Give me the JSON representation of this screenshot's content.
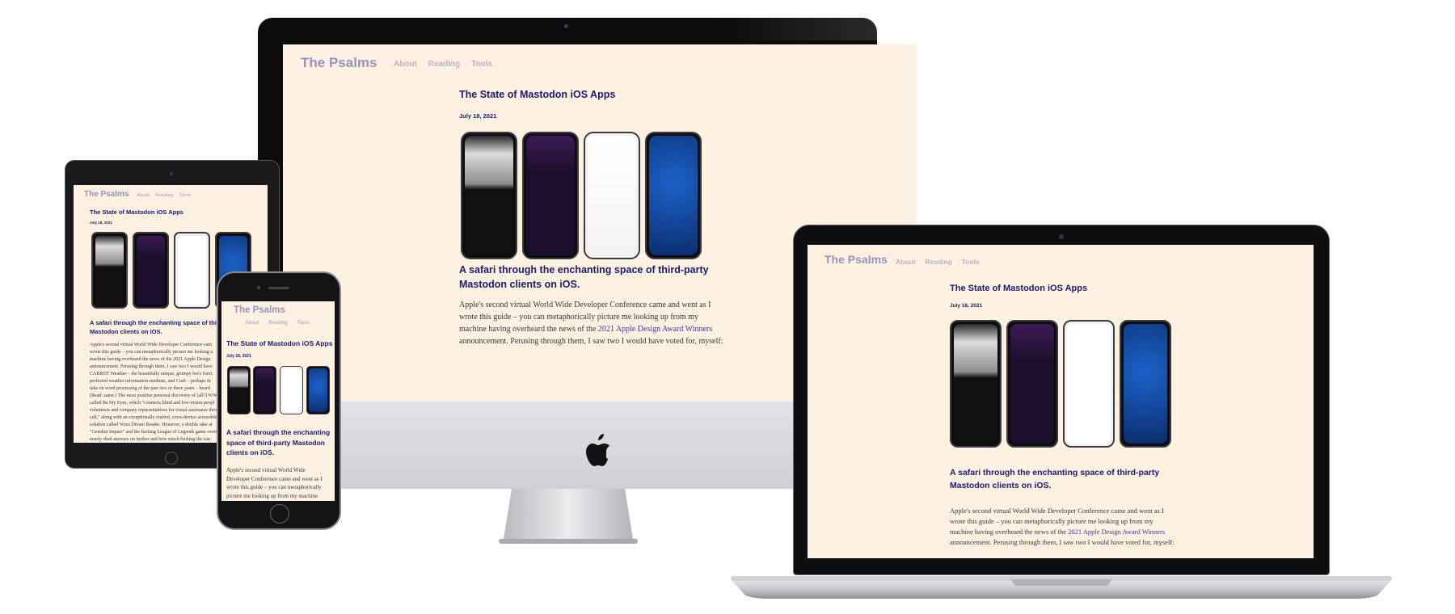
{
  "site": {
    "brand": "The Psalms",
    "nav": [
      "About",
      "Reading",
      "Tools"
    ],
    "post_title": "The State of Mastodon iOS Apps",
    "post_date": "July 18, 2021",
    "subtitle": "A safari through the enchanting space of third-party Mastodon clients on iOS.",
    "subtitle_line1": "A safari through the enchanting space of third-party",
    "subtitle_line2": "Mastodon clients on iOS.",
    "body_lines": [
      "Apple's second virtual World Wide Developer Conference came and went as I",
      "wrote this guide – you can metaphorically picture me looking up from my",
      "machine having overheard the news of the ",
      "announcement. Perusing through them, I saw two I would have voted for, myself:"
    ],
    "link_text": "2021 Apple Design Award Winners"
  },
  "ipad": {
    "subtitle_line1": "A safari through the enchanting space of third-p",
    "subtitle_line2": "Mastodon clients on iOS.",
    "body_lines": [
      "Apple's second virtual World Wide Developer Conference cam",
      "wrote this guide – you can metaphorically picture me looking u",
      "machine having overheard the news of the 2021 Apple Design",
      "announcement. Perusing through them, I saw two I would have",
      "CARROT Weather – the beautifully unique, grumpy bot's forec",
      "preferred weather information medium, and Craft – perhaps th",
      "take on word processing of the past two or three years – heard",
      "(Read: saner.) The most positive personal discovery of [all?] WW",
      "called Be My Eyes, which \"connects blind and low-vision peopl",
      "volunteers and company representatives for visual assistance thro",
      "call,\" along with an exceptionally crafted, cross-device accessible",
      "solution called Voice Dream Reader. However, a double take at",
      "\"Genshin Impact\" and the fucking League of Legends game overt",
      "nearly shed answers on further and how much fucking the can"
    ]
  },
  "iphone": {
    "subtitle_lines": [
      "A safari through the enchanting",
      "space of third-party Mastodon",
      "clients on iOS."
    ],
    "body_lines": [
      "Apple's second virtual World Wide",
      "Developer Conference came and went as I",
      "wrote this guide – you can metaphorically",
      "picture me looking up from my machine"
    ]
  },
  "colors": {
    "page_bg": "#fdf1e1",
    "brand": "#9b91c1",
    "nav": "#b9b0cd",
    "heading": "#1d1a6e",
    "link": "#3d37b0"
  },
  "app_screens": [
    {
      "name": "map-timeline",
      "bg": "#111111"
    },
    {
      "name": "purple-menu",
      "bg": "#1d0f2b"
    },
    {
      "name": "light-feed",
      "bg": "#ffffff"
    },
    {
      "name": "home-screen-icons",
      "bg": "#0b3a8c"
    }
  ]
}
